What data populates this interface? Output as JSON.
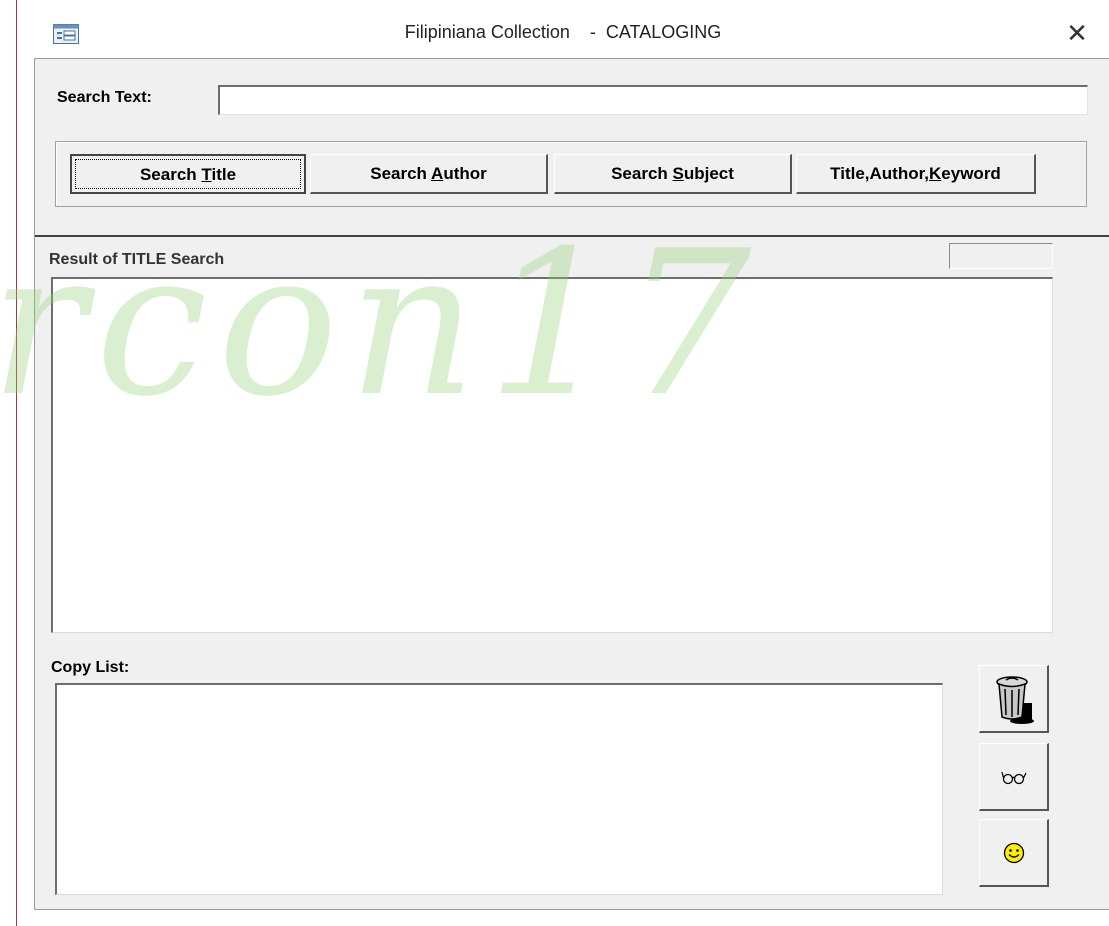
{
  "window": {
    "title": "Filipiniana Collection    -  CATALOGING",
    "close_glyph": "✕"
  },
  "search": {
    "label": "Search Text:",
    "value": "",
    "placeholder": ""
  },
  "buttons": [
    {
      "pre": "Search ",
      "key": "T",
      "post": "itle",
      "active": true
    },
    {
      "pre": "Search ",
      "key": "A",
      "post": "uthor",
      "active": false
    },
    {
      "pre": "Search ",
      "key": "S",
      "post": "ubject",
      "active": false
    },
    {
      "pre": "Title,Author,",
      "key": "K",
      "post": "eyword",
      "active": false
    }
  ],
  "results": {
    "label": "Result of TITLE Search",
    "count": ""
  },
  "copy_list": {
    "label": "Copy List:"
  },
  "tools": {
    "trash_icon": "trash-can-icon",
    "view_icon": "eyeglasses-icon",
    "smiley_icon": "smiley-face-icon"
  },
  "watermark": {
    "text": "rcon17"
  },
  "colors": {
    "form_background": "#f0f0f0",
    "window_border": "#a33a3a",
    "watermark": "#96d278",
    "smiley": "#ffee00"
  }
}
